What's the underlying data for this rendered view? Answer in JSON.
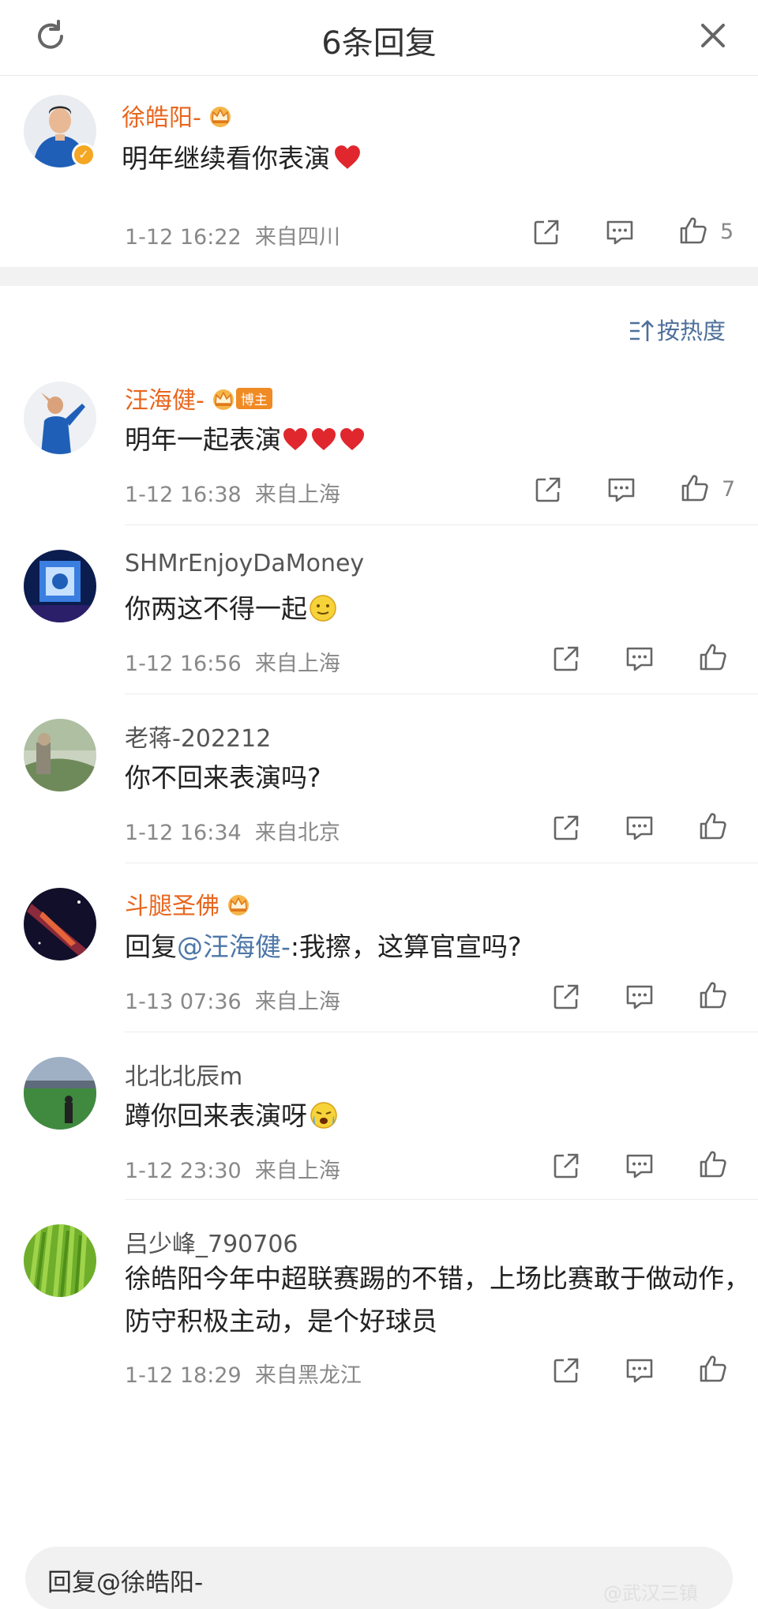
{
  "header": {
    "title": "6条回复"
  },
  "root_comment": {
    "name": "徐皓阳-",
    "text": "明年继续看你表演",
    "time": "1-12 16:22",
    "location": "来自四川",
    "likes": "5"
  },
  "sort_label": "按热度",
  "replies": [
    {
      "name": "汪海健-",
      "badge": "博主",
      "text": "明年一起表演",
      "time": "1-12 16:38",
      "location": "来自上海",
      "likes": "7"
    },
    {
      "name": "SHMrEnjoyDaMoney",
      "text": "你两这不得一起",
      "time": "1-12 16:56",
      "location": "来自上海"
    },
    {
      "name": "老蒋-202212",
      "text": "你不回来表演吗?",
      "time": "1-12 16:34",
      "location": "来自北京"
    },
    {
      "name": "斗腿圣佛",
      "text_prefix": "回复",
      "mention": "@汪海健-",
      "text_suffix": ":我擦，这算官宣吗?",
      "time": "1-13 07:36",
      "location": "来自上海"
    },
    {
      "name": "北北北辰m",
      "text": "蹲你回来表演呀",
      "time": "1-12 23:30",
      "location": "来自上海"
    },
    {
      "name": "吕少峰_790706",
      "text": "徐皓阳今年中超联赛踢的不错，上场比赛敢于做动作，防守积极主动，是个好球员",
      "time": "1-12 18:29",
      "location": "来自黑龙江"
    }
  ],
  "reply_input": {
    "placeholder": "回复@徐皓阳-"
  },
  "watermark": "@武汉三镇",
  "colors": {
    "accent_orange": "#e8661e",
    "link_blue": "#4d77a8",
    "heart_red": "#e0272d"
  }
}
